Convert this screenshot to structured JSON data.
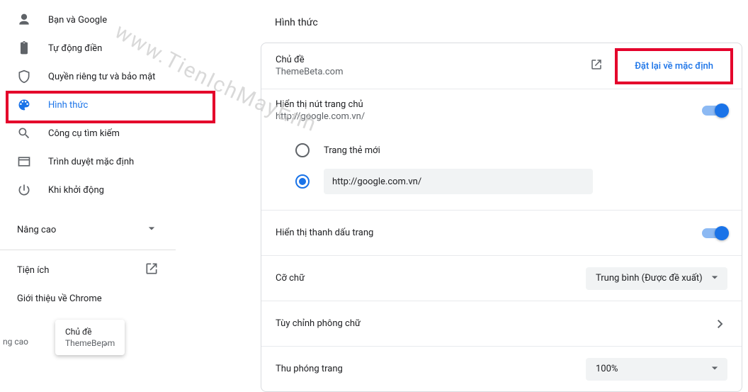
{
  "sidebar": {
    "items": [
      {
        "label": "Bạn và Google",
        "icon": "person"
      },
      {
        "label": "Tự động điền",
        "icon": "clipboard"
      },
      {
        "label": "Quyền riêng tư và bảo mật",
        "icon": "shield"
      },
      {
        "label": "Hình thức",
        "icon": "palette"
      },
      {
        "label": "Công cụ tìm kiếm",
        "icon": "search"
      },
      {
        "label": "Trình duyệt mặc định",
        "icon": "browser"
      },
      {
        "label": "Khi khởi động",
        "icon": "power"
      }
    ],
    "advanced": "Nâng cao",
    "extensions": "Tiện ích",
    "about": "Giới thiệu về Chrome"
  },
  "main": {
    "section_title": "Hình thức",
    "theme": {
      "label": "Chủ đề",
      "value": "ThemeBeta.com",
      "reset": "Đặt lại về mặc định"
    },
    "home_button": {
      "label": "Hiển thị nút trang chủ",
      "sub": "http://google.com.vn/",
      "enabled": true,
      "option_newtab": "Trang thẻ mới",
      "option_url_value": "http://google.com.vn/"
    },
    "bookmarks_bar": {
      "label": "Hiển thị thanh dấu trang",
      "enabled": true
    },
    "font_size": {
      "label": "Cỡ chữ",
      "value": "Trung bình (Được đề xuất)"
    },
    "customize_fonts": {
      "label": "Tùy chỉnh phông chữ"
    },
    "page_zoom": {
      "label": "Thu phóng trang",
      "value": "100%"
    }
  },
  "floating": {
    "chip": "ng cao",
    "card_title": "Chủ đề",
    "card_sub": "ThemeBeթm"
  },
  "watermark": "www.TienIchMayեnh"
}
